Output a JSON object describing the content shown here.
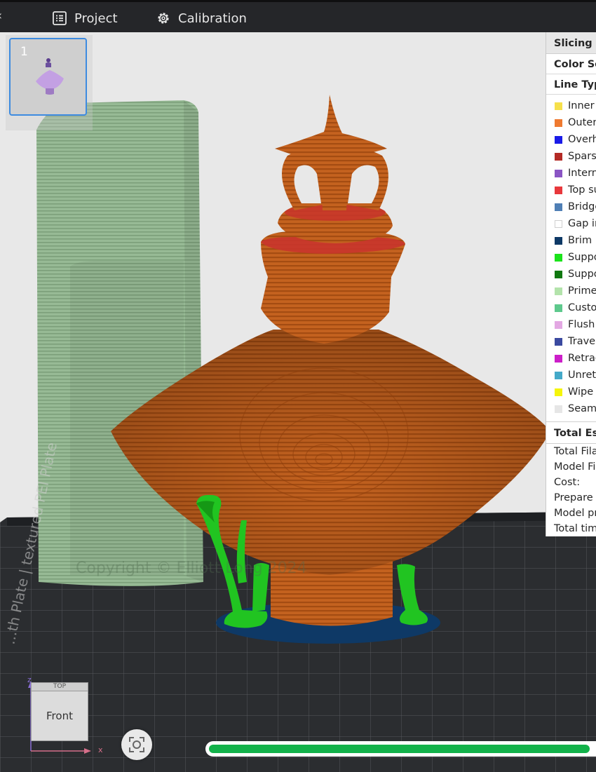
{
  "topbar": {
    "tabs": [
      {
        "label": "Project",
        "icon": "project-icon"
      },
      {
        "label": "Calibration",
        "icon": "calibration-icon"
      }
    ]
  },
  "viewport": {
    "plate_number": "1",
    "watermark": "Copyright © Elliott Long 2024",
    "bed_text": "...th Plate | textured PEI Plate"
  },
  "panel": {
    "title": "Slicing R",
    "color_scheme": "Color Sc",
    "line_type_header": "Line Typ",
    "legend": [
      {
        "label": "Inner",
        "color": "#f6e04b"
      },
      {
        "label": "Outer",
        "color": "#ef7a30"
      },
      {
        "label": "Overh",
        "color": "#1a1be8"
      },
      {
        "label": "Sparse",
        "color": "#b42a25"
      },
      {
        "label": "Intern",
        "color": "#8a55c4"
      },
      {
        "label": "Top su",
        "color": "#e8383c"
      },
      {
        "label": "Bridge",
        "color": "#4f7fb5"
      },
      {
        "label": "Gap in",
        "color": "#ffffff"
      },
      {
        "label": "Brim",
        "color": "#0e3966"
      },
      {
        "label": "Suppo",
        "color": "#1be31b"
      },
      {
        "label": "Suppo",
        "color": "#107810"
      },
      {
        "label": "Prime",
        "color": "#b3e3ab"
      },
      {
        "label": "Custo",
        "color": "#5ec98d"
      },
      {
        "label": "Flush",
        "color": "#e3a8e3"
      },
      {
        "label": "Travel",
        "color": "#3b4aa0"
      },
      {
        "label": "Retrac",
        "color": "#cc1fc9"
      },
      {
        "label": "Unret",
        "color": "#44a9c9"
      },
      {
        "label": "Wipe",
        "color": "#f5f50a"
      },
      {
        "label": "Seams",
        "color": "#e6e6e6"
      }
    ],
    "estimate_header": "Total Est",
    "estimates": [
      "Total Fila",
      "Model Fil",
      "Cost:",
      "Prepare",
      "Model pr",
      "Total tim"
    ]
  },
  "viewcube": {
    "front_label": "Front",
    "top_label": "TOP",
    "axis_x": "x",
    "axis_z": "z"
  },
  "progress": {
    "fraction": 0.97,
    "color": "#12b24a"
  },
  "colors": {
    "model": "#c4621f",
    "tower": "#95b893",
    "support": "#21c421",
    "brim": "#0e3966",
    "bed": "#2b2d30"
  }
}
